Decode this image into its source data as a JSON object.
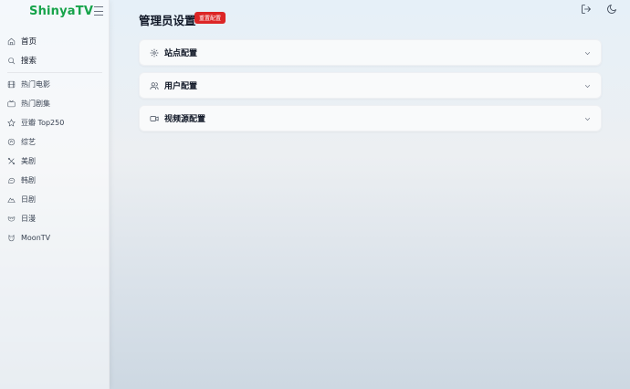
{
  "app": {
    "brand": "ShinyaTV"
  },
  "sidebar": {
    "items": [
      {
        "label": "首页",
        "icon": "home-icon"
      },
      {
        "label": "搜索",
        "icon": "search-icon"
      },
      {
        "label": "热门电影",
        "icon": "film-icon"
      },
      {
        "label": "热门剧集",
        "icon": "tv-icon"
      },
      {
        "label": "豆瓣 Top250",
        "icon": "star-icon"
      },
      {
        "label": "综艺",
        "icon": "sparkle-icon"
      },
      {
        "label": "美剧",
        "icon": "cross-icon"
      },
      {
        "label": "韩剧",
        "icon": "bubble-icon"
      },
      {
        "label": "日剧",
        "icon": "mountain-icon"
      },
      {
        "label": "日漫",
        "icon": "drama-icon"
      },
      {
        "label": "MoonTV",
        "icon": "cat-icon"
      }
    ]
  },
  "header": {
    "title": "管理员设置",
    "reset_label": "重置配置"
  },
  "sections": [
    {
      "title": "站点配置",
      "icon": "gear-icon"
    },
    {
      "title": "用户配置",
      "icon": "users-icon"
    },
    {
      "title": "视频源配置",
      "icon": "video-icon"
    }
  ],
  "colors": {
    "brand": "#16a34a",
    "danger": "#dc2626"
  }
}
